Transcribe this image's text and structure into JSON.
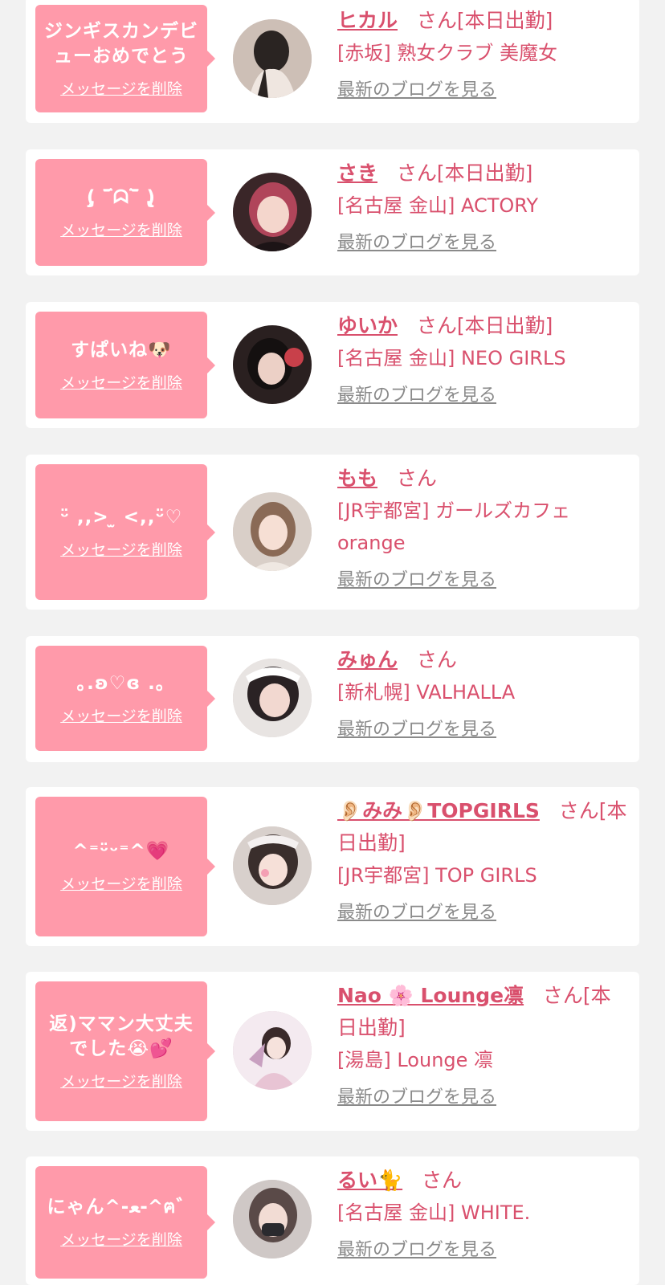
{
  "cards": [
    {
      "message": "ジンギスカンデビューおめでとう",
      "delete_label": "メッセージを削除",
      "name": "ヒカル",
      "san": "さん",
      "status": "[本日出勤]",
      "shop": "[赤坂] 熟女クラブ 美魔女",
      "blog_label": "最新のブログを見る"
    },
    {
      "message": "(̨̡ ‾᷄ᗣ‾᷅ )̧̢",
      "delete_label": "メッセージを削除",
      "name": "さき",
      "san": "さん",
      "status": "[本日出勤]",
      "shop": "[名古屋 金山] ACTORY",
      "blog_label": "最新のブログを見る"
    },
    {
      "message": "すぱいね🐶",
      "delete_label": "メッセージを削除",
      "name": "ゆいか",
      "san": "さん",
      "status": "[本日出勤]",
      "shop": "[名古屋 金山] NEO GIRLS",
      "blog_label": "最新のブログを見る"
    },
    {
      "message": "ᵕ̈ ,,> ̫ <,,ᵕ̈♡",
      "delete_label": "メッセージを削除",
      "name": "もも",
      "san": "さん",
      "status": "",
      "shop": "[JR宇都宮] ガールズカフェ orange",
      "blog_label": "最新のブログを見る"
    },
    {
      "message": "｡.ʚ♡ɞ .｡",
      "delete_label": "メッセージを削除",
      "name": "みゅん",
      "san": "さん",
      "status": "",
      "shop": "[新札幌] VALHALLA",
      "blog_label": "最新のブログを見る"
    },
    {
      "message": "^⁼ᵕ̈ᵕ⁼^💗",
      "delete_label": "メッセージを削除",
      "name": "👂🏻みみ👂🏻TOPGIRLS",
      "san": "さん",
      "status": "[本日出勤]",
      "shop": "[JR宇都宮] TOP GIRLS",
      "blog_label": "最新のブログを見る"
    },
    {
      "message": "返)ママン大丈夫でした😭💕",
      "delete_label": "メッセージを削除",
      "name": "Nao 🌸 Lounge凛",
      "san": "さん",
      "status": "[本日出勤]",
      "shop": "[湯島] Lounge 凛",
      "blog_label": "最新のブログを見る"
    },
    {
      "message": "にゃん^-ﻌ-^ฅ゛",
      "delete_label": "メッセージを削除",
      "name": "るい🐈",
      "san": "さん",
      "status": "",
      "shop": "[名古屋 金山] WHITE.",
      "blog_label": "最新のブログを見る"
    }
  ]
}
